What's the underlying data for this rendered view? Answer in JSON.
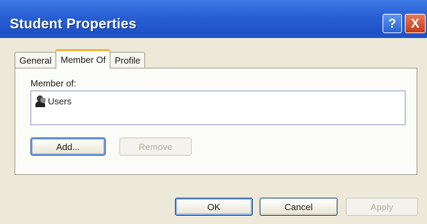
{
  "window": {
    "title": "Student Properties",
    "help_label": "?",
    "close_label": "X"
  },
  "tabs": [
    {
      "label": "General",
      "active": false
    },
    {
      "label": "Member Of",
      "active": true
    },
    {
      "label": "Profile",
      "active": false
    }
  ],
  "member_of": {
    "label": "Member of:",
    "items": [
      {
        "label": "Users",
        "icon": "user-group-icon"
      }
    ]
  },
  "buttons": {
    "add": "Add...",
    "remove": "Remove",
    "ok": "OK",
    "cancel": "Cancel",
    "apply": "Apply"
  },
  "colors": {
    "titlebar": "#2a5fd4",
    "active_tab_accent": "#f2b540",
    "close_button": "#c33b15"
  }
}
